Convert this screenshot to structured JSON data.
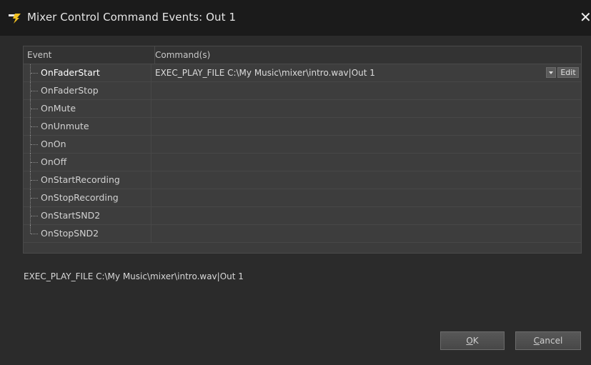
{
  "window": {
    "title": "Mixer Control Command Events: Out 1",
    "close_glyph": "✕"
  },
  "grid": {
    "columns": {
      "event": "Event",
      "commands": "Command(s)"
    },
    "rows": [
      {
        "event": "OnFaderStart",
        "command": "EXEC_PLAY_FILE C:\\My Music\\mixer\\intro.wav|Out 1",
        "selected": true
      },
      {
        "event": "OnFaderStop",
        "command": ""
      },
      {
        "event": "OnMute",
        "command": ""
      },
      {
        "event": "OnUnmute",
        "command": ""
      },
      {
        "event": "OnOn",
        "command": ""
      },
      {
        "event": "OnOff",
        "command": ""
      },
      {
        "event": "OnStartRecording",
        "command": ""
      },
      {
        "event": "OnStopRecording",
        "command": ""
      },
      {
        "event": "OnStartSND2",
        "command": ""
      },
      {
        "event": "OnStopSND2",
        "command": ""
      }
    ],
    "edit_label": "Edit"
  },
  "status": {
    "text": "EXEC_PLAY_FILE C:\\My Music\\mixer\\intro.wav|Out 1"
  },
  "buttons": {
    "ok": {
      "mnemonic": "O",
      "rest": "K"
    },
    "cancel": {
      "mnemonic": "C",
      "rest": "ancel"
    }
  },
  "colors": {
    "background": "#2b2b2b",
    "titlebar": "#1b1b1b",
    "grid": "#3c3c3c",
    "icon_accent": "#f0c020"
  }
}
